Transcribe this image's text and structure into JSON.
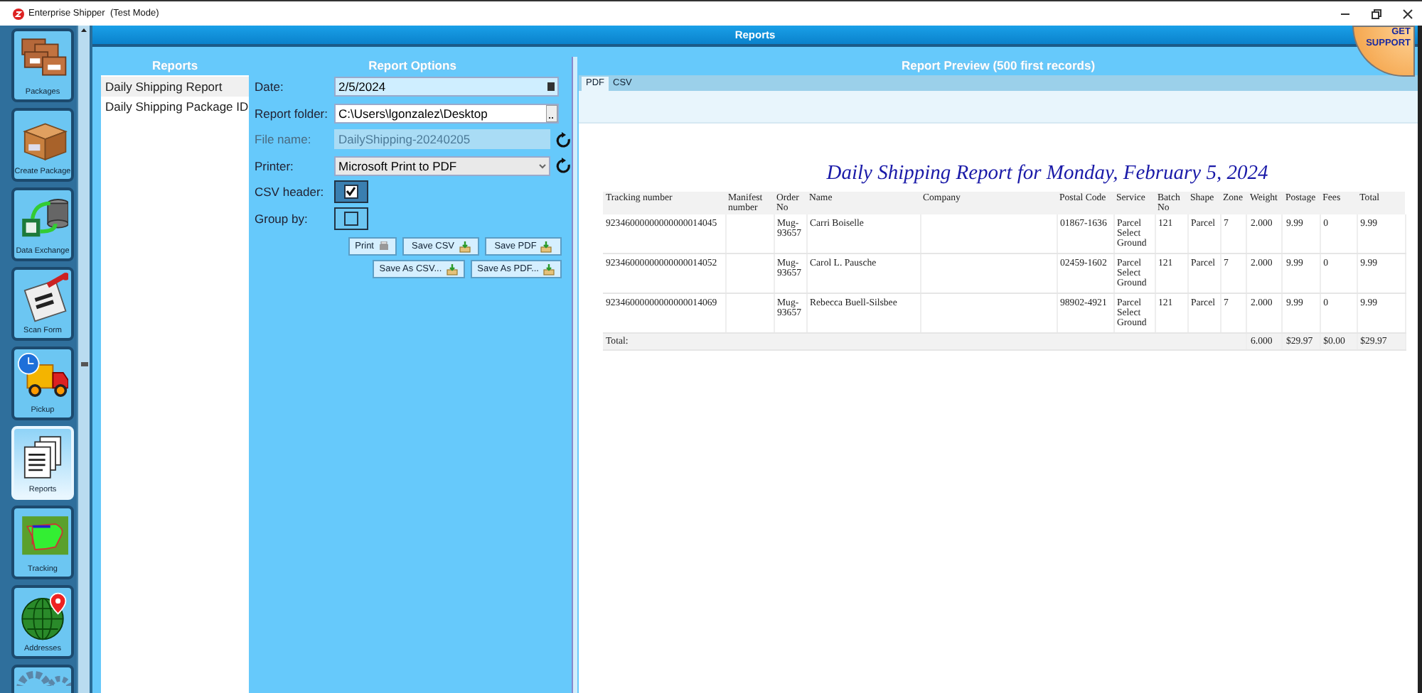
{
  "window": {
    "title": "Enterprise Shipper  (Test Mode)"
  },
  "header": {
    "title": "Reports"
  },
  "support_badge": {
    "lines": [
      "GET",
      "SUPPORT"
    ]
  },
  "sidebar": {
    "items": [
      {
        "label": "Packages",
        "kind": "packages",
        "selected": false
      },
      {
        "label": "Create Package",
        "kind": "create",
        "selected": false
      },
      {
        "label": "Data Exchange",
        "kind": "exchange",
        "selected": false
      },
      {
        "label": "Scan Form",
        "kind": "scanform",
        "selected": false
      },
      {
        "label": "Pickup",
        "kind": "pickup",
        "selected": false
      },
      {
        "label": "Reports",
        "kind": "reports",
        "selected": true
      },
      {
        "label": "Tracking",
        "kind": "tracking",
        "selected": false
      },
      {
        "label": "Addresses",
        "kind": "addresses",
        "selected": false
      },
      {
        "kind": "settings",
        "selected": false
      }
    ]
  },
  "reports": {
    "title": "Reports",
    "items": [
      {
        "label": "Daily Shipping Report",
        "selected": true
      },
      {
        "label": "Daily Shipping Package ID",
        "selected": false
      }
    ]
  },
  "options": {
    "title": "Report Options",
    "fields": [
      {
        "kind": "date",
        "label": "Date:",
        "value": "2/5/2024",
        "disabled": false
      },
      {
        "kind": "folder",
        "label": "Report folder:",
        "value": "C:\\Users\\lgonzalez\\Desktop",
        "disabled": false
      },
      {
        "kind": "file",
        "label": "File name:",
        "value": "DailyShipping-20240205",
        "disabled": true
      },
      {
        "kind": "select",
        "label": "Printer:",
        "value": "Microsoft Print to PDF",
        "disabled": false
      },
      {
        "kind": "checkbox",
        "label": "CSV header:",
        "checked": true
      },
      {
        "kind": "checkbox",
        "label": "Group by:",
        "checked": false
      }
    ],
    "button_rows": [
      [
        {
          "label": "Print",
          "kind": "print"
        },
        {
          "label": "Save CSV",
          "kind": "save"
        },
        {
          "label": "Save PDF",
          "kind": "save"
        }
      ],
      [
        {
          "label": "Save As CSV...",
          "kind": "save"
        },
        {
          "label": "Save As PDF...",
          "kind": "save"
        }
      ]
    ]
  },
  "preview": {
    "title": "Report Preview (500 first records)",
    "tabs": [
      {
        "label": "PDF",
        "selected": true
      },
      {
        "label": "CSV",
        "selected": false
      }
    ],
    "document": {
      "title": "Daily Shipping Report for Monday, February 5, 2024",
      "columns": [
        "Tracking number",
        "Manifest number",
        "Order No",
        "Name",
        "Company",
        "Postal Code",
        "Service",
        "Batch No",
        "Shape",
        "Zone",
        "Weight",
        "Postage",
        "Fees",
        "Total"
      ],
      "rows": [
        [
          "92346000000000000014045",
          null,
          "Mug-93657",
          "Carri Boiselle",
          null,
          "01867-1636",
          "Parcel Select Ground",
          "121",
          "Parcel",
          "7",
          "2.000",
          "9.99",
          "0",
          "9.99"
        ],
        [
          "92346000000000000014052",
          null,
          "Mug-93657",
          "Carol L. Pausche",
          null,
          "02459-1602",
          "Parcel Select Ground",
          "121",
          "Parcel",
          "7",
          "2.000",
          "9.99",
          "0",
          "9.99"
        ],
        [
          "92346000000000000014069",
          null,
          "Mug-93657",
          "Rebecca Buell-Silsbee",
          null,
          "98902-4921",
          "Parcel Select Ground",
          "121",
          "Parcel",
          "7",
          "2.000",
          "9.99",
          "0",
          "9.99"
        ]
      ],
      "total": {
        "label": "Total:",
        "values": [
          "6.000",
          "$29.97",
          "$0.00",
          "$29.97"
        ]
      }
    }
  }
}
